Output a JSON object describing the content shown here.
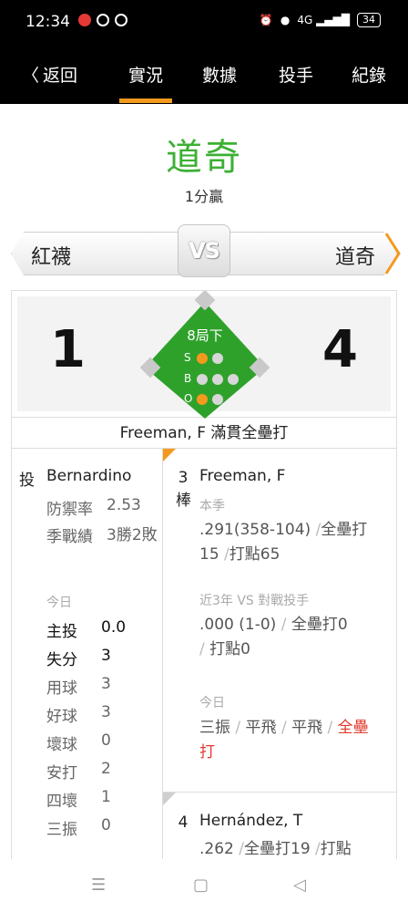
{
  "status_bar": {
    "time": "12:34",
    "battery": "34",
    "network": "4G"
  },
  "nav": {
    "back_label": "返回",
    "tabs": [
      {
        "label": "實況",
        "active": true
      },
      {
        "label": "數據",
        "active": false
      },
      {
        "label": "投手",
        "active": false
      },
      {
        "label": "紀錄",
        "active": false
      }
    ]
  },
  "game": {
    "winner": "道奇",
    "margin": "1分贏",
    "away_team": "紅襪",
    "home_team": "道奇",
    "vs_label": "VS",
    "away_score": "1",
    "home_score": "4",
    "inning": "8局下",
    "count": {
      "s_label": "S",
      "b_label": "B",
      "o_label": "O",
      "strikes": 1,
      "balls": 0,
      "outs": 1
    },
    "play_text": "Freeman, F 滿貫全壘打"
  },
  "pitcher": {
    "role": "投",
    "name": "Bernardino",
    "era_label": "防禦率",
    "era": "2.53",
    "record_label": "季戰績",
    "record": "3勝2敗",
    "today_label": "今日",
    "today": [
      {
        "label": "主投",
        "value": "0.0"
      },
      {
        "label": "失分",
        "value": "3"
      },
      {
        "label": "用球",
        "value": "3"
      },
      {
        "label": "好球",
        "value": "3"
      },
      {
        "label": "壞球",
        "value": "0"
      },
      {
        "label": "安打",
        "value": "2"
      },
      {
        "label": "四壞",
        "value": "1"
      },
      {
        "label": "三振",
        "value": "0"
      }
    ]
  },
  "batter": {
    "order": "3",
    "order_suffix": "棒",
    "name": "Freeman, F",
    "season_label": "本季",
    "season_avg": ".291(358-104)",
    "season_hr": "全壘打15",
    "season_rbi": "打點65",
    "vs_label": "近3年 VS 對戰投手",
    "vs_avg": ".000 (1-0)",
    "vs_hr": "全壘打0",
    "vs_rbi": "打點0",
    "today_label": "今日",
    "today_results": [
      "三振",
      "平飛",
      "平飛"
    ],
    "today_hr": "全壘打"
  },
  "next_batter": {
    "order": "4",
    "name": "Hernández, T",
    "avg": ".262",
    "hr": "全壘打19",
    "rbi": "打點"
  },
  "system_nav": {
    "menu": "☰",
    "home": "▢",
    "back": "◁"
  },
  "colors": {
    "accent": "#f39a1e",
    "green": "#3cb034",
    "field": "#2ea12b",
    "hr_red": "#e23b2e"
  }
}
